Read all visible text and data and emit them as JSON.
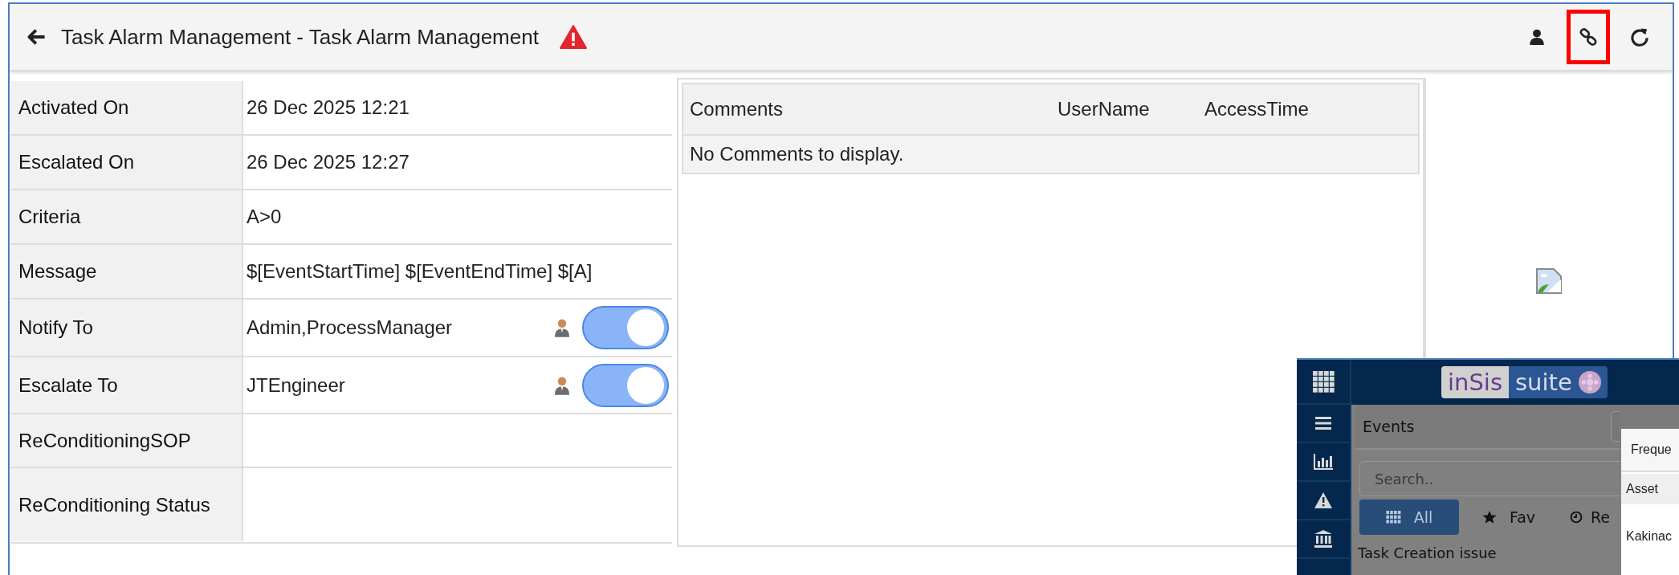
{
  "header": {
    "title": "Task Alarm Management - Task Alarm Management",
    "alert": true,
    "tools": [
      {
        "kind": "user",
        "highlighted": false
      },
      {
        "kind": "link",
        "highlighted": true
      },
      {
        "kind": "refresh",
        "highlighted": false
      }
    ]
  },
  "details": [
    {
      "kind": "text",
      "label": "Activated On",
      "value": "26 Dec 2025 12:21"
    },
    {
      "kind": "text",
      "label": "Escalated On",
      "value": "26 Dec 2025 12:27"
    },
    {
      "kind": "text",
      "label": "Criteria",
      "value": "A>0"
    },
    {
      "kind": "text",
      "label": "Message",
      "value": "$[EventStartTime] $[EventEndTime] $[A]"
    },
    {
      "kind": "recipient",
      "label": "Notify To",
      "value": "Admin,ProcessManager",
      "on": true
    },
    {
      "kind": "recipient",
      "label": "Escalate To",
      "value": "JTEngineer",
      "on": true
    },
    {
      "kind": "text",
      "label": "ReConditioningSOP"
    },
    {
      "kind": "text",
      "label": "ReConditioning Status"
    }
  ],
  "comments": {
    "columns": [
      "Comments",
      "UserName",
      "AccessTime"
    ],
    "empty_message": "No Comments to display."
  },
  "inset": {
    "logo": [
      "inSis",
      "suite"
    ],
    "rail": [
      {
        "kind": "menu"
      },
      {
        "kind": "chart"
      },
      {
        "kind": "warning"
      },
      {
        "kind": "bank"
      }
    ],
    "panel_title": "Events",
    "search": {
      "placeholder": "Search.."
    },
    "tabs": [
      {
        "kind": "grid",
        "label": "All",
        "selected": true
      },
      {
        "kind": "star",
        "label": "Fav",
        "selected": false
      },
      {
        "kind": "clock",
        "label": "Re",
        "selected": false
      }
    ],
    "item": "Task Creation issue",
    "popup": {
      "heading": "Freque",
      "column": "Asset",
      "cell": "Kakinac"
    }
  }
}
